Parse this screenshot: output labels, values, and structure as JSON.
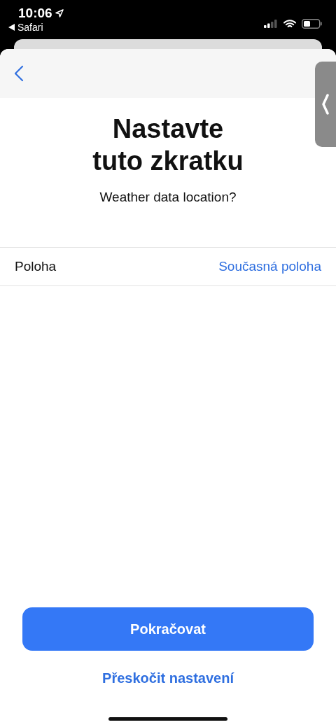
{
  "status_bar": {
    "time": "10:06",
    "back_app": "Safari"
  },
  "title": "Nastavte\ntuto zkratku",
  "subtitle": "Weather data location?",
  "rows": [
    {
      "label": "Poloha",
      "value": "Současná poloha"
    }
  ],
  "primary_button": "Pokračovat",
  "secondary_button": "Přeskočit nastavení"
}
